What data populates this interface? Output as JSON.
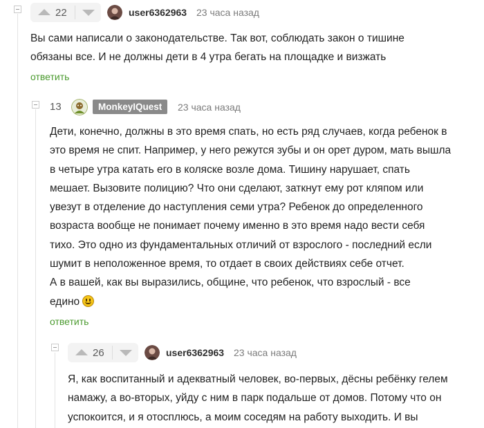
{
  "comments": [
    {
      "rating": "22",
      "user": "user6362963",
      "time": "23 часа назад",
      "text_lines": [
        "Вы сами написали о законодательстве. Так вот, соблюдать закон о тишине",
        "обязаны все. И не должны дети в 4 утра бегать на площадке и визжать"
      ],
      "reply_label": "ответить"
    },
    {
      "rating": "13",
      "user": "MonkeyIQuest",
      "time": "23 часа назад",
      "text_lines": [
        "Дети, конечно, должны в это время спать, но есть ряд случаев, когда ребенок в",
        "это время не спит. Например, у него режутся зубы и он орет дуром, мать вышла",
        "в четыре утра катать его в коляске возле дома. Тишину нарушает, спать",
        "мешает. Вызовите полицию? Что они сделают, заткнут ему рот кляпом или",
        "увезут в отделение до наступления семи утра? Ребенок до определенного",
        "возраста вообще не понимает почему именно в это время надо вести себя",
        "тихо. Это одно из фундаментальных отличий от взрослого - последний если",
        "шумит в неположенное время, то отдает в своих действиях себе отчет.",
        "А в вашей, как вы выразились, общине, что ребенок, что взрослый - все",
        "едино"
      ],
      "reply_label": "ответить"
    },
    {
      "rating": "26",
      "user": "user6362963",
      "time": "23 часа назад",
      "text_lines": [
        "Я, как воспитанный и адекватный человек, во-первых, дёсны ребёнку гелем",
        "намажу, а во-вторых, уйду с ним в парк подальше от домов. Потому что он",
        "успокоится, и я отосплюсь, а моим соседям на работу выходить. И вы"
      ]
    }
  ],
  "icons": {
    "vote_up": "arrow-up-icon",
    "vote_down": "arrow-down-icon",
    "collapse": "collapse-minus-icon",
    "emoji": "smiling-face-icon"
  },
  "colors": {
    "reply_link": "#4a9a2e",
    "badge_bg": "#8a8a8a"
  }
}
